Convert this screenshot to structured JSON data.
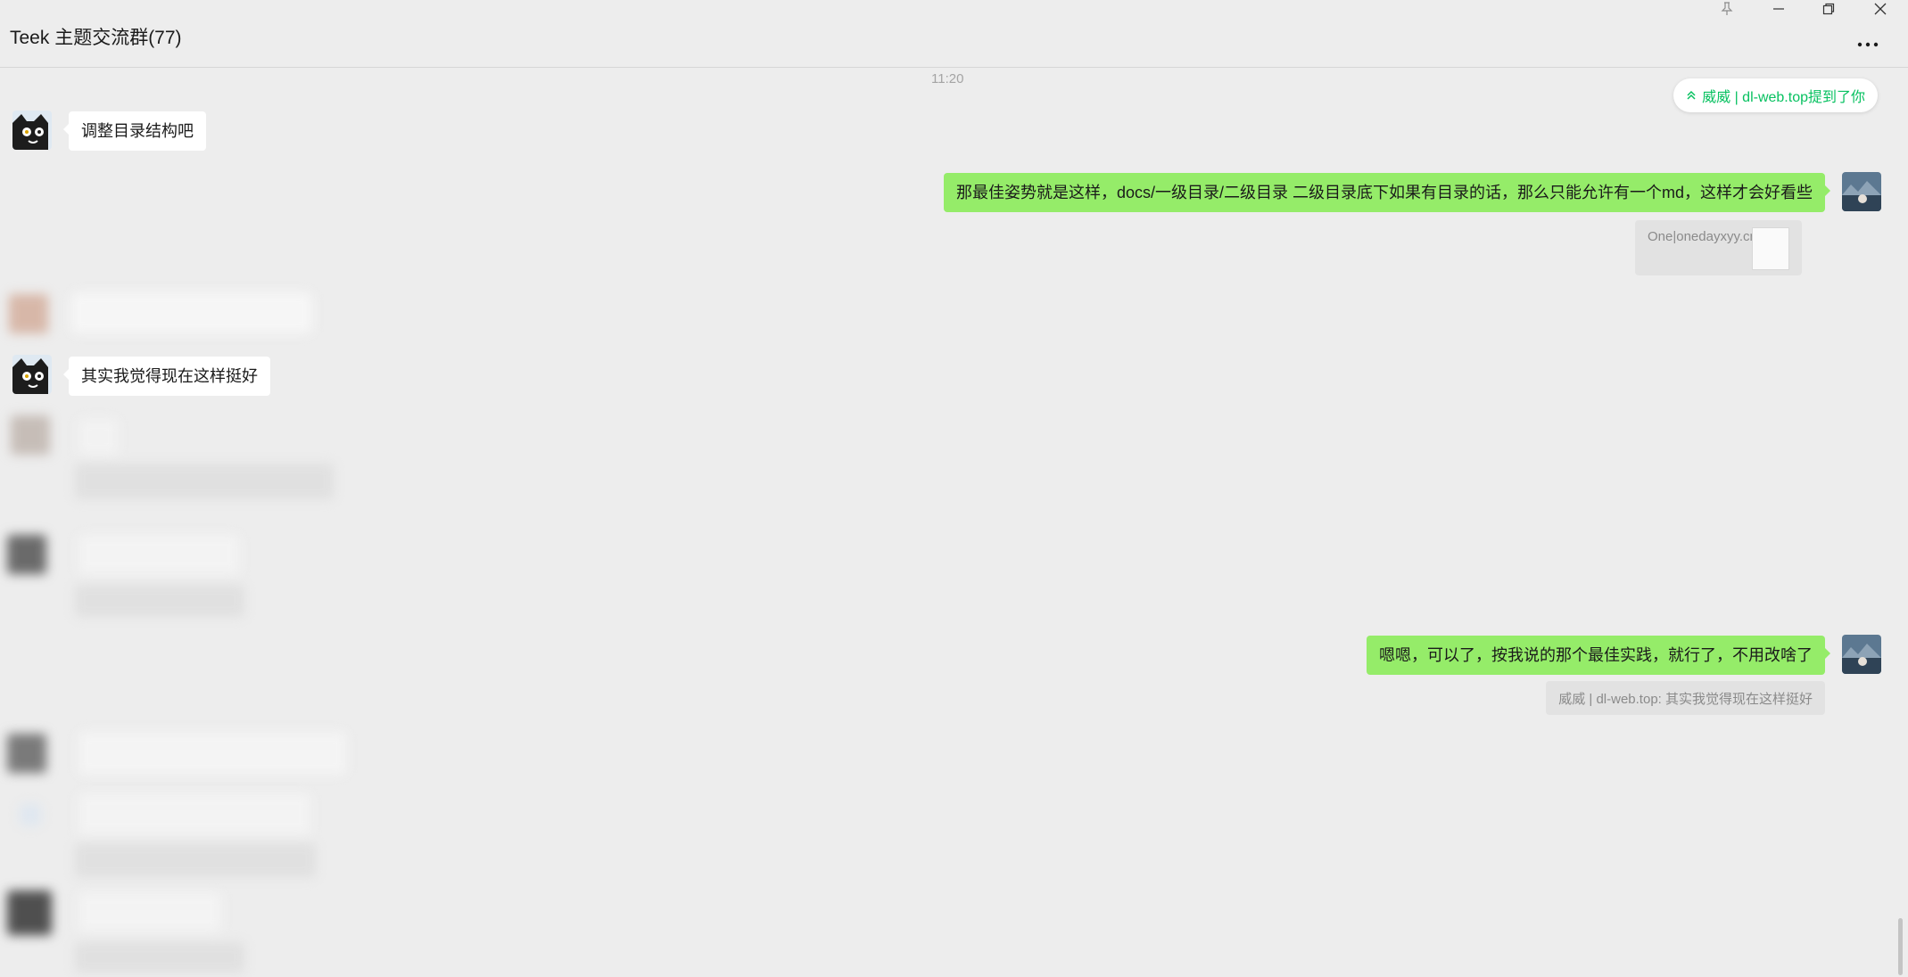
{
  "window": {
    "title": "Teek 主题交流群(77)",
    "controls": [
      "pin-icon",
      "minimize-icon",
      "maximize-icon",
      "close-icon"
    ],
    "more_icon": "more-dots-icon"
  },
  "colors": {
    "background": "#ededed",
    "incoming_bubble": "#ffffff",
    "outgoing_bubble": "#95ec69",
    "quote_bg": "#e2e2e2",
    "mention_text": "#07c160"
  },
  "chat": {
    "timestamp": "11:20",
    "mention_banner": "威威 | dl-web.top提到了你",
    "messages": [
      {
        "direction": "in",
        "text": "调整目录结构吧"
      },
      {
        "direction": "out",
        "text": "那最佳姿势就是这样，docs/一级目录/二级目录      二级目录底下如果有目录的话，那么只能允许有一个md，这样才会好看些",
        "quote": "One|onedayxyy.cn:"
      },
      {
        "direction": "in",
        "text": "其实我觉得现在这样挺好"
      },
      {
        "direction": "out",
        "text": "嗯嗯，可以了，按我说的那个最佳实践，就行了，不用改啥了",
        "quote": "威威 | dl-web.top: 其实我觉得现在这样挺好"
      }
    ]
  }
}
